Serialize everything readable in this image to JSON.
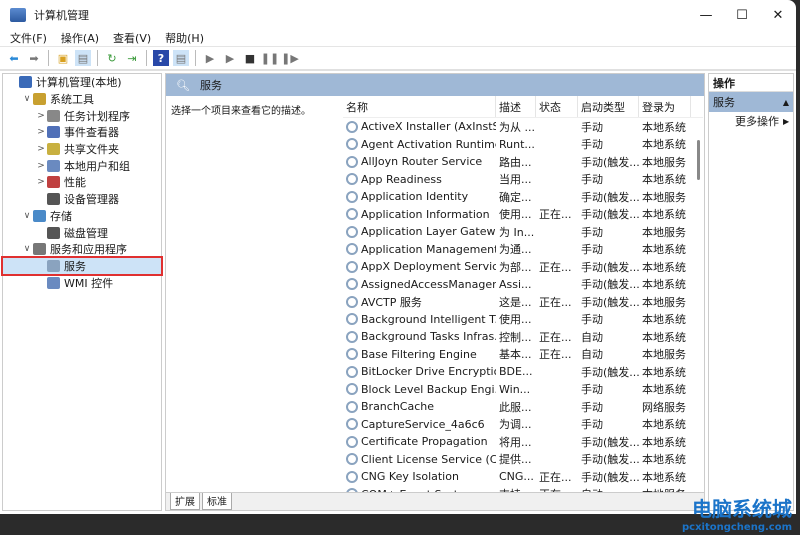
{
  "window": {
    "title": "计算机管理",
    "controls": [
      "—",
      "☐",
      "✕"
    ]
  },
  "menu": [
    "文件(F)",
    "操作(A)",
    "查看(V)",
    "帮助(H)"
  ],
  "toolbar": [
    "back-icon",
    "forward-icon",
    "up-icon",
    "show-tree-icon",
    "refresh-icon",
    "export-icon",
    "help-icon",
    "view-icon",
    "start-icon",
    "start-alt-icon",
    "stop-icon",
    "pause-icon",
    "resume-icon"
  ],
  "tree": [
    {
      "label": "计算机管理(本地)",
      "level": 0,
      "arrow": ""
    },
    {
      "label": "系统工具",
      "level": 1,
      "arrow": "∨"
    },
    {
      "label": "任务计划程序",
      "level": 2,
      "arrow": ">"
    },
    {
      "label": "事件查看器",
      "level": 2,
      "arrow": ">"
    },
    {
      "label": "共享文件夹",
      "level": 2,
      "arrow": ">"
    },
    {
      "label": "本地用户和组",
      "level": 2,
      "arrow": ">"
    },
    {
      "label": "性能",
      "level": 2,
      "arrow": ">"
    },
    {
      "label": "设备管理器",
      "level": 2,
      "arrow": ""
    },
    {
      "label": "存储",
      "level": 1,
      "arrow": "∨"
    },
    {
      "label": "磁盘管理",
      "level": 2,
      "arrow": ""
    },
    {
      "label": "服务和应用程序",
      "level": 1,
      "arrow": "∨"
    },
    {
      "label": "服务",
      "level": 2,
      "arrow": "",
      "selected": true
    },
    {
      "label": "WMI 控件",
      "level": 2,
      "arrow": ""
    }
  ],
  "main": {
    "header": "服务",
    "description": "选择一个项目来查看它的描述。",
    "columns": [
      "名称",
      "描述",
      "状态",
      "启动类型",
      "登录为"
    ],
    "rows": [
      [
        "ActiveX Installer (AxInstSV)",
        "为从 ...",
        "",
        "手动",
        "本地系统"
      ],
      [
        "Agent Activation Runtime...",
        "Runt...",
        "",
        "手动",
        "本地系统"
      ],
      [
        "AllJoyn Router Service",
        "路由...",
        "",
        "手动(触发...",
        "本地服务"
      ],
      [
        "App Readiness",
        "当用...",
        "",
        "手动",
        "本地系统"
      ],
      [
        "Application Identity",
        "确定...",
        "",
        "手动(触发...",
        "本地服务"
      ],
      [
        "Application Information",
        "使用...",
        "正在...",
        "手动(触发...",
        "本地系统"
      ],
      [
        "Application Layer Gatewa...",
        "为 In...",
        "",
        "手动",
        "本地服务"
      ],
      [
        "Application Management",
        "为通...",
        "",
        "手动",
        "本地系统"
      ],
      [
        "AppX Deployment Servic...",
        "为部...",
        "正在...",
        "手动(触发...",
        "本地系统"
      ],
      [
        "AssignedAccessManager...",
        "Assi...",
        "",
        "手动(触发...",
        "本地系统"
      ],
      [
        "AVCTP 服务",
        "这是...",
        "正在...",
        "手动(触发...",
        "本地服务"
      ],
      [
        "Background Intelligent T...",
        "使用...",
        "",
        "手动",
        "本地系统"
      ],
      [
        "Background Tasks Infras...",
        "控制...",
        "正在...",
        "自动",
        "本地系统"
      ],
      [
        "Base Filtering Engine",
        "基本...",
        "正在...",
        "自动",
        "本地服务"
      ],
      [
        "BitLocker Drive Encryptio...",
        "BDE...",
        "",
        "手动(触发...",
        "本地系统"
      ],
      [
        "Block Level Backup Engi...",
        "Win...",
        "",
        "手动",
        "本地系统"
      ],
      [
        "BranchCache",
        "此服...",
        "",
        "手动",
        "网络服务"
      ],
      [
        "CaptureService_4a6c6",
        "为调...",
        "",
        "手动",
        "本地系统"
      ],
      [
        "Certificate Propagation",
        "将用...",
        "",
        "手动(触发...",
        "本地系统"
      ],
      [
        "Client License Service (Cli...",
        "提供...",
        "",
        "手动(触发...",
        "本地系统"
      ],
      [
        "CNG Key Isolation",
        "CNG...",
        "正在...",
        "手动(触发...",
        "本地系统"
      ],
      [
        "COM+ Event System",
        "支持...",
        "正在...",
        "自动",
        "本地服务"
      ]
    ],
    "tabs": [
      "扩展",
      "标准"
    ]
  },
  "actions": {
    "header": "操作",
    "section": "服务",
    "more": "更多操作"
  },
  "watermark": {
    "title": "电脑系统城",
    "url": "pcxitongcheng.com"
  }
}
